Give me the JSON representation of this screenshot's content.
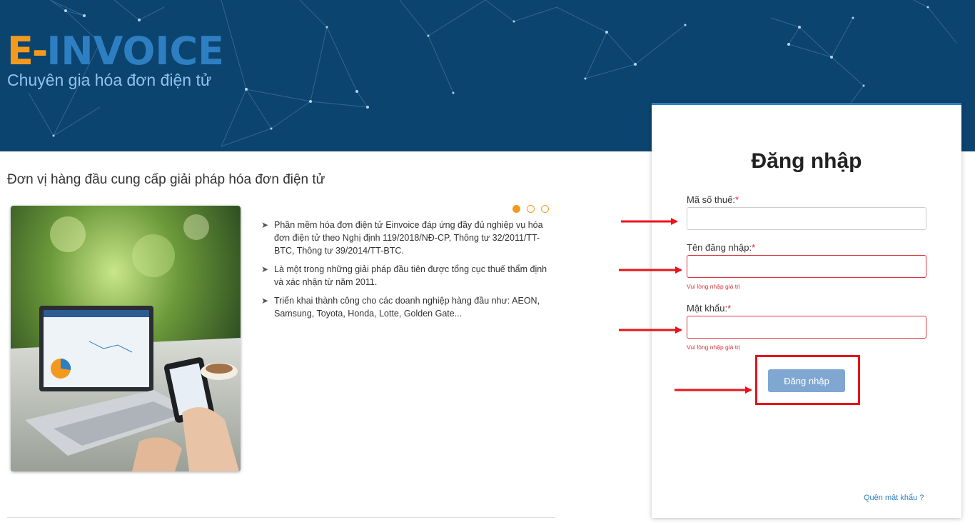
{
  "header": {
    "logo": {
      "e": "E-",
      "rest": "INVOICE"
    },
    "tagline": "Chuyên gia hóa đơn điện tử"
  },
  "intro": {
    "lead": "Đơn vị hàng đầu cung cấp giải pháp hóa đơn điện tử",
    "slider": {
      "count": 3,
      "active_index": 0
    },
    "features": [
      "Phần mềm hóa đơn điện tử Einvoice đáp ứng đầy đủ nghiệp vụ hóa đơn điện tử theo Nghị định 119/2018/NĐ-CP, Thông tư 32/2011/TT-BTC, Thông tư 39/2014/TT-BTC.",
      "Là một trong những giải pháp đầu tiên được tổng cục thuế thẩm định và xác nhận từ năm 2011.",
      "Triển khai thành công cho các doanh nghiệp hàng đầu như: AEON, Samsung, Toyota, Honda, Lotte, Golden Gate..."
    ]
  },
  "login": {
    "title": "Đăng nhập",
    "fields": [
      {
        "label": "Mã số thuế:",
        "required_mark": "*",
        "value": "",
        "error": ""
      },
      {
        "label": "Tên đăng nhập:",
        "required_mark": "*",
        "value": "",
        "error": "Vui lòng nhập giá trị"
      },
      {
        "label": "Mật khẩu:",
        "required_mark": "*",
        "value": "",
        "error": "Vui lòng nhập giá trị"
      }
    ],
    "submit_label": "Đăng nhập",
    "forgot_label": "Quên mật khẩu ?"
  },
  "colors": {
    "banner": "#0c4470",
    "brand_orange": "#f39a1e",
    "brand_blue": "#2e7fc2",
    "error_red": "#d9323a",
    "button": "#7fa7d1",
    "annotation_red": "#e8141b"
  }
}
